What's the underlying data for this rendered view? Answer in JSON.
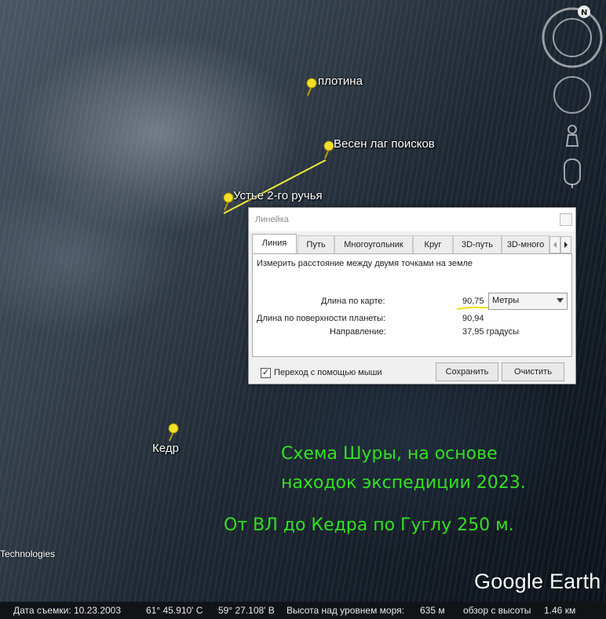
{
  "map": {
    "placemarks": [
      {
        "label": "плотина"
      },
      {
        "label": "Весен лаг поисков"
      },
      {
        "label": "Устье 2-го ручья"
      },
      {
        "label": "Кедр"
      }
    ],
    "annotation_line1": "Схема Шуры, на основе",
    "annotation_line2": "находок экспедиции 2023.",
    "annotation_line3": "От ВЛ до Кедра по Гуглу 250 м.",
    "attribution": "Technologies",
    "logo": "Google Earth",
    "compass_letter": "N",
    "colors": {
      "annotation": "#33e020",
      "pin": "#f2e02a",
      "ruler_line": "#f5e83a"
    }
  },
  "ruler_dialog": {
    "title": "Линейка",
    "tabs": [
      "Линия",
      "Путь",
      "Многоугольник",
      "Круг",
      "3D-путь",
      "3D-много"
    ],
    "active_tab": "Линия",
    "description": "Измерить расстояние между двумя точками на земле",
    "map_length_label": "Длина по карте:",
    "map_length_value": "90,75",
    "unit_selected": "Метры",
    "ground_length_label": "Длина по поверхности планеты:",
    "ground_length_value": "90,94",
    "heading_label": "Направление:",
    "heading_value": "37,95 градусы",
    "mouse_nav_label": "Переход с помощью мыши",
    "mouse_nav_checked": true,
    "save_label": "Сохранить",
    "clear_label": "Очистить"
  },
  "status": {
    "date": "Дата съемки: 10.23.2003",
    "lat": "61° 45.910' С",
    "lon": "59° 27.108' В",
    "elev_label": "Высота над уровнем моря:",
    "elev_value": "635 м",
    "eye_label": "обзор с высоты",
    "eye_value": "1.46 км"
  }
}
